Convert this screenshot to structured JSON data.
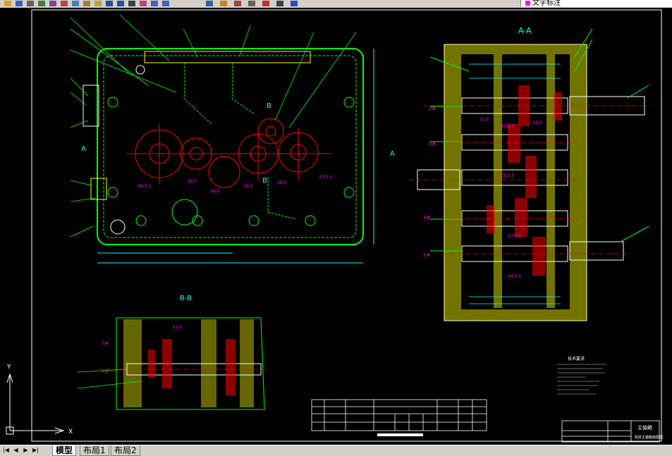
{
  "toolbar": {
    "buttons": [
      "open-icon",
      "save-icon",
      "print-icon",
      "preview-icon",
      "publish-icon",
      "cut-icon",
      "copy-icon",
      "paste-icon",
      "match-properties-icon",
      "undo-icon",
      "redo-icon",
      "pan-icon",
      "zoom-realtime-icon",
      "zoom-window-icon",
      "zoom-previous-icon",
      "properties-icon",
      "design-center-icon",
      "tool-palettes-icon",
      "sheet-set-icon",
      "markup-icon",
      "calc-icon",
      "help-icon"
    ],
    "layer_text": "文字标注",
    "layer_color": "#ff00ff"
  },
  "drawing": {
    "section_aa": "A-A",
    "section_bb": "B-B",
    "mark_a": "A",
    "mark_b": "B",
    "gear_labels": [
      "44/3.5",
      "36/3",
      "26/3",
      "36/3",
      "26/3",
      "27/3.5",
      "21/2",
      "41/2.5",
      "26/3",
      "44/3.5",
      "23/3.5",
      "27/3.5"
    ],
    "shaft_labels": [
      "2#",
      "4#",
      "3#",
      "1#",
      "5#",
      "4#"
    ],
    "tech_title": "技术要求",
    "title_block_text": "主轴箱",
    "title_block_sub": "机床主轴箱装配图"
  },
  "statusbar": {
    "tabs": [
      "模型",
      "布局1",
      "布局2"
    ],
    "active_tab": "模型"
  },
  "colors": {
    "background": "#000000",
    "gear": "#ff0000",
    "housing": "#00ff00",
    "hatch": "#ffff00",
    "leader": "#00ffff",
    "text": "#ff00ff"
  }
}
